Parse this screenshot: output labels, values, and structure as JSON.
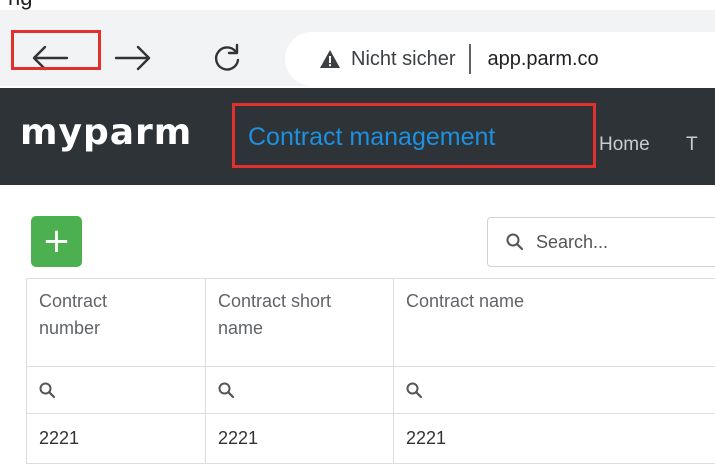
{
  "top_fragment": "ng",
  "browser": {
    "security_label": "Nicht sicher",
    "url": "app.parm.co"
  },
  "app": {
    "logo": "myparm",
    "title": "Contract management",
    "nav": [
      "Home",
      "T"
    ]
  },
  "toolbar": {
    "add_label": "+",
    "search_placeholder": "Search..."
  },
  "table": {
    "columns": [
      {
        "line1": "Contract",
        "line2": "number"
      },
      {
        "line1": "Contract short",
        "line2": "name"
      },
      {
        "line1": "Contract name",
        "line2": ""
      }
    ],
    "rows": [
      [
        "2221",
        "2221",
        "2221"
      ]
    ]
  },
  "colors": {
    "header_bg": "#2e3338",
    "title_blue": "#1e90e0",
    "add_green": "#4caf50",
    "highlight_red": "#e2302c",
    "warning_grey": "#3c4043"
  },
  "icons": {
    "back": "arrow-left-icon",
    "forward": "arrow-right-icon",
    "reload": "reload-icon",
    "security": "warning-triangle-icon",
    "search": "magnifier-icon"
  }
}
